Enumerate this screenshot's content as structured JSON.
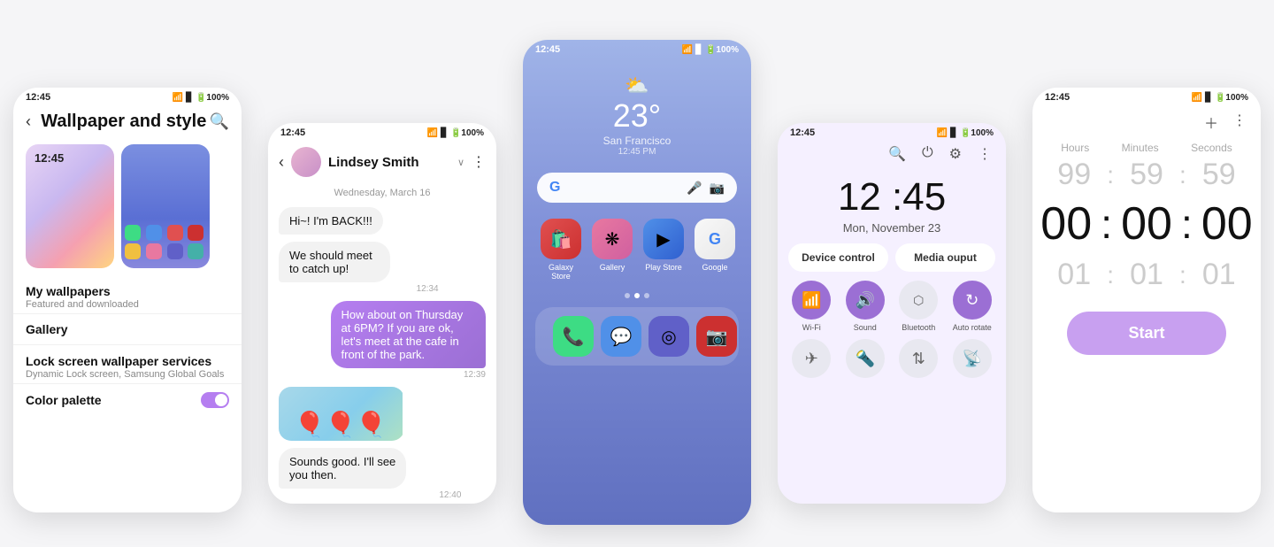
{
  "phone1": {
    "status_time": "12:45",
    "title": "Wallpaper and style",
    "preview_time": "12:45",
    "sections": [
      {
        "title": "My wallpapers",
        "sub": "Featured and downloaded"
      },
      {
        "title": "Gallery",
        "sub": ""
      },
      {
        "title": "Lock screen wallpaper services",
        "sub": "Dynamic Lock screen, Samsung Global Goals"
      },
      {
        "title": "Color palette",
        "sub": ""
      }
    ]
  },
  "phone2": {
    "status_time": "12:45",
    "contact_name": "Lindsey Smith",
    "date_label": "Wednesday, March 16",
    "messages": [
      {
        "text": "Hi~! I'm BACK!!!",
        "side": "left",
        "time": ""
      },
      {
        "text": "We should meet to catch up!",
        "side": "left",
        "time": "12:34"
      },
      {
        "text": "How about on Thursday at 6PM? If you are ok, let's meet at the cafe in front of the park.",
        "side": "right",
        "time": "12:39"
      },
      {
        "text": "Sounds good. I'll see you then.",
        "side": "left",
        "time": "12:40"
      }
    ]
  },
  "phone3": {
    "status_time": "12:45",
    "weather_temp": "23°",
    "weather_city": "San Francisco",
    "weather_time": "12:45 PM",
    "apps_row1": [
      {
        "label": "Galaxy Store",
        "emoji": "🛍️",
        "color": "#e05050"
      },
      {
        "label": "Gallery",
        "emoji": "❋",
        "color": "#e878a0"
      },
      {
        "label": "Play Store",
        "emoji": "▶",
        "color": "#5090e8"
      },
      {
        "label": "Google",
        "emoji": "G",
        "color": "#f8f8f8"
      }
    ],
    "dock": [
      {
        "label": "",
        "emoji": "📞",
        "color": "#3ddc84"
      },
      {
        "label": "",
        "emoji": "💬",
        "color": "#5090e8"
      },
      {
        "label": "",
        "emoji": "◎",
        "color": "#6060c8"
      },
      {
        "label": "",
        "emoji": "📷",
        "color": "#cc3030"
      }
    ]
  },
  "phone4": {
    "status_time": "12:45",
    "clock_time": "12 :45",
    "clock_date": "Mon, November 23",
    "btn_device": "Device control",
    "btn_media": "Media ouput",
    "toggles": [
      {
        "label": "Wi-Fi",
        "icon": "📶",
        "on": true
      },
      {
        "label": "Sound",
        "icon": "🔊",
        "on": true
      },
      {
        "label": "Bluetooth",
        "icon": "🔵",
        "on": false
      },
      {
        "label": "Auto rotate",
        "icon": "↻",
        "on": true
      },
      {
        "label": "",
        "icon": "✈",
        "on": false
      },
      {
        "label": "",
        "icon": "🔦",
        "on": false
      },
      {
        "label": "",
        "icon": "⇅",
        "on": false
      },
      {
        "label": "",
        "icon": "📡",
        "on": false
      }
    ]
  },
  "phone5": {
    "status_time": "12:45",
    "col_hours": "Hours",
    "col_minutes": "Minutes",
    "col_seconds": "Seconds",
    "inactive_top": [
      "99",
      "59",
      "59"
    ],
    "active": [
      "00",
      "00",
      "00"
    ],
    "inactive_bottom": [
      "01",
      "01",
      "01"
    ],
    "start_label": "Start"
  }
}
